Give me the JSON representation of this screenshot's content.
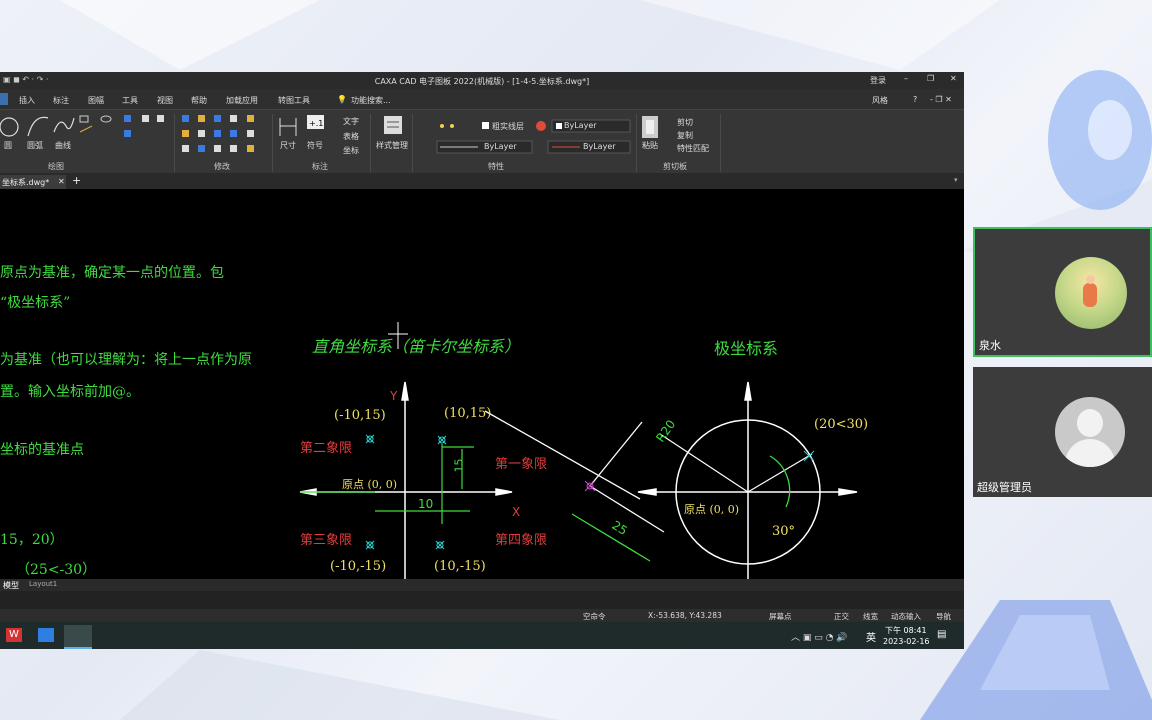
{
  "window": {
    "title": "CAXA CAD 电子图板 2022(机械版) - [1-4-5.坐标系.dwg*]",
    "login": "登录",
    "style_label": "风格"
  },
  "ribbon_tabs": [
    "插入",
    "标注",
    "图幅",
    "工具",
    "视图",
    "帮助",
    "加载应用",
    "转图工具"
  ],
  "ribbon_search": "功能搜索...",
  "ribbon": {
    "draw_items": [
      "圆",
      "圆弧",
      "曲线"
    ],
    "group_draw": "绘图",
    "group_modify": "修改",
    "dim_items": [
      "尺寸",
      "符号"
    ],
    "dim_text": "文字",
    "dim_table": "表格",
    "dim_coord": "坐标",
    "group_dim": "标注",
    "style_manage": "样式管理",
    "layer_name": "粗实线层",
    "bylayer1": "ByLayer",
    "bylayer2": "ByLayer",
    "bylayer3": "ByLayer",
    "group_props": "特性",
    "paste": "粘贴",
    "cut": "剪切",
    "copy": "复制",
    "match": "特性匹配",
    "group_clipboard": "剪切板"
  },
  "doc_tab": "坐标系.dwg*",
  "drawing": {
    "left_text": [
      "原点为基准，确定某一点的位置。包",
      "“极坐标系”",
      "为基准（也可以理解为：将上一点作为原",
      "置。输入坐标前加@。",
      "坐标的基准点",
      "15，20）",
      "（25<-30）"
    ],
    "cart_title": "直角坐标系（笛卡尔坐标系）",
    "polar_title": "极坐标系",
    "y_axis": "Y",
    "x_axis": "X",
    "q2": "第二象限",
    "q1": "第一象限",
    "q3": "第三象限",
    "q4": "第四象限",
    "p_tl": "(-10,15)",
    "p_tr": "(10,15)",
    "p_bl": "(-10,-15)",
    "p_br": "(10,-15)",
    "origin": "原点 (0, 0)",
    "dim_10": "10",
    "dim_15": "15",
    "r20": "R20",
    "dim_25": "25",
    "polar_pt": "(20<30)",
    "polar_origin": "原点 (0, 0)",
    "angle": "30°"
  },
  "layout_tabs": [
    "模型",
    "Layout1"
  ],
  "status": {
    "cmd": "空命令",
    "coords": "X:-53.638, Y:43.283",
    "screen_pt": "屏幕点",
    "ortho": "正交",
    "linewidth": "线宽",
    "dyn_input": "动态输入",
    "nav": "导航"
  },
  "taskbar": {
    "ime": "英",
    "time": "下午 08:41",
    "date": "2023-02-16"
  },
  "participants": [
    "泉水",
    "超级管理员"
  ],
  "colors": {
    "green": "#3fdc3f",
    "red": "#e23c3c",
    "accent_border": "#3fbf5f"
  }
}
